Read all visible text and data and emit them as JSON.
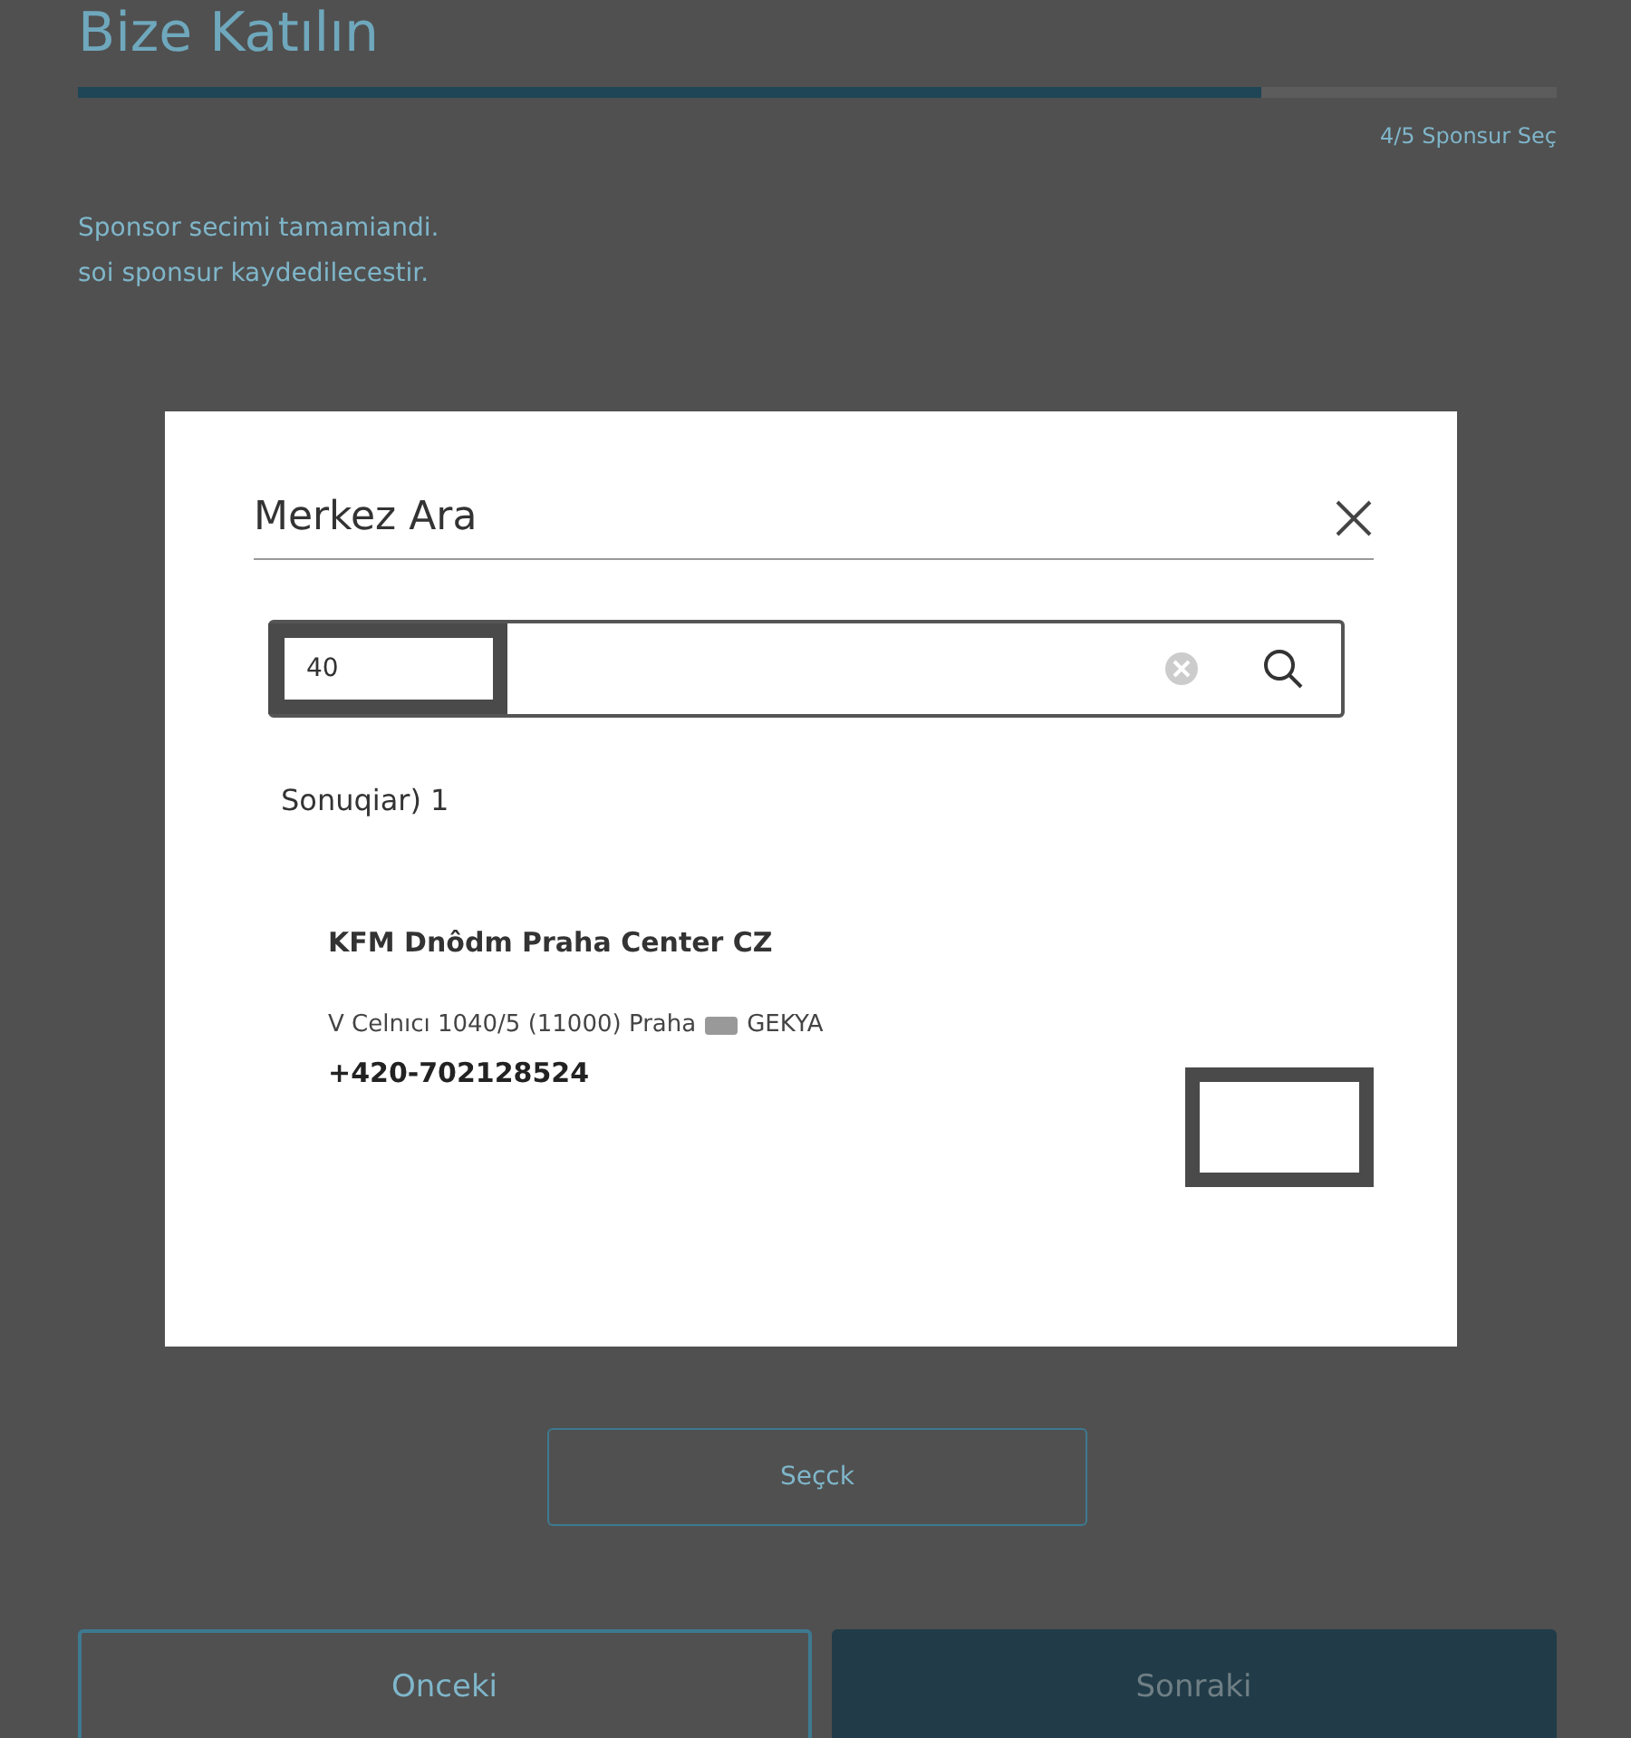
{
  "page": {
    "title": "Bize Katılın",
    "progress": {
      "level": 0.8
    },
    "step_label": "4/5 Sponsur Seç",
    "intro_lines": [
      "Sponsor secimi tamamiandi.",
      "soi sponsur kaydedilecestir."
    ],
    "select_button": "Seçck",
    "buttons": [
      {
        "label": "Onceki",
        "kind": "outline"
      },
      {
        "label": "Sonraki",
        "kind": "filled"
      }
    ]
  },
  "dialog": {
    "title": "Merkez Ara",
    "search": {
      "value": "40"
    },
    "result_count": "Sonuqiar) 1",
    "results": [
      {
        "name": "KFM Dnôdm Praha Center CZ",
        "address_start": "V Celnıcı 1040/5 (11000) Praha",
        "address_end": "GEKYA",
        "phone": "+420-702128524"
      }
    ]
  }
}
